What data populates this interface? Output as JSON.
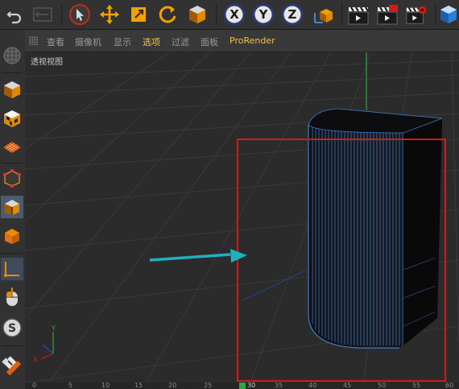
{
  "toolbar": {
    "axis_x_label": "X",
    "axis_y_label": "Y",
    "axis_z_label": "Z"
  },
  "menu": {
    "items": [
      "查看",
      "摄像机",
      "显示",
      "选项",
      "过滤",
      "面板",
      "ProRender"
    ]
  },
  "viewport": {
    "label": "透视视图"
  },
  "timeline": {
    "ticks": [
      "0",
      "5",
      "10",
      "15",
      "20",
      "25",
      "30",
      "35",
      "40",
      "45",
      "50",
      "55",
      "60"
    ],
    "current_frame": "30"
  },
  "colors": {
    "accent_orange": "#f0a300",
    "menu_highlight": "#f0c23c",
    "selection_box": "#d21a1a",
    "arrow": "#1fb1c0",
    "wireframe": "#3d7cc9",
    "y_axis_green": "#2fa544"
  }
}
